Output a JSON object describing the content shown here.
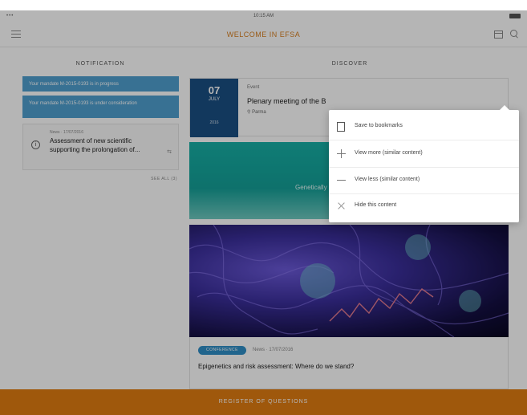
{
  "status_bar": {
    "time": "10:15 AM",
    "carrier": "•••"
  },
  "nav": {
    "title": "WELCOME IN EFSA"
  },
  "notification": {
    "title": "NOTIFICATION",
    "bars": [
      "Your mandate M-2015-0193 is in progress",
      "Your mandate M-2015-0193 is under consideration"
    ],
    "card": {
      "meta": "News · 17/07/2016",
      "text": "Assessment of new scientific supporting the prolongation of..."
    },
    "see_all": "SEE ALL (3)"
  },
  "discover": {
    "title": "DISCOVER",
    "event": {
      "day": "07",
      "month": "JULY",
      "year": "2016",
      "type": "Event",
      "title": "Plenary meeting of the B",
      "location": "Parma"
    },
    "teal_label": "Genetically",
    "article": {
      "tag": "CONFERENCE",
      "meta": "News · 17/07/2016",
      "title": "Epigenetics and risk assessment: Where do we stand?"
    }
  },
  "popover": {
    "items": [
      {
        "label": "Save to bookmarks",
        "icon": "bookmark-icon"
      },
      {
        "label": "View more (similar content)",
        "icon": "plus-icon"
      },
      {
        "label": "View less (similar content)",
        "icon": "minus-icon"
      },
      {
        "label": "Hide this content",
        "icon": "close-icon"
      }
    ]
  },
  "bottom_bar": {
    "label": "REGISTER OF QUESTIONS"
  },
  "colors": {
    "accent": "#e07d12",
    "notification_blue": "#4f9fcf",
    "date_navy": "#1a4f84",
    "teal": "#17b0a6"
  }
}
